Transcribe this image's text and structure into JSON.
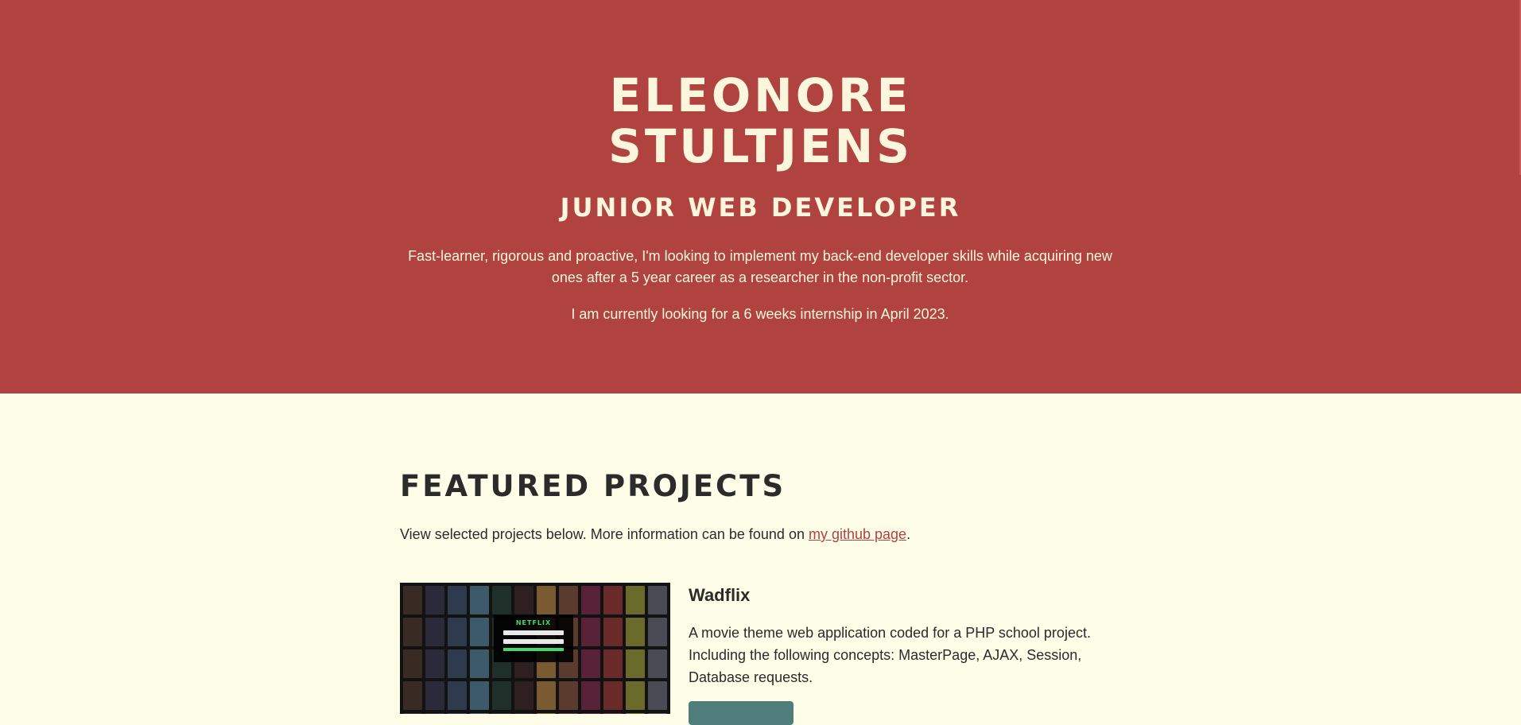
{
  "hero": {
    "name_line1": "ELEONORE",
    "name_line2": "STULTJENS",
    "role": "JUNIOR WEB DEVELOPER",
    "bio": "Fast-learner, rigorous and proactive, I'm looking to implement my back-end developer skills while acquiring new ones after a 5 year career as a researcher in the non-profit sector.",
    "availability": "I am currently looking for a 6 weeks internship in April 2023."
  },
  "projects": {
    "title": "FEATURED PROJECTS",
    "intro_prefix": "View selected projects below. More information can be found on ",
    "intro_link": "my github page",
    "intro_suffix": ".",
    "items": [
      {
        "name": "Wadflix",
        "description": "A movie theme web application coded for a PHP school project. Including the following concepts: MasterPage, AJAX, Session, Database requests.",
        "thumbnail_logo": "NETFLIX",
        "button_label": ""
      }
    ]
  },
  "colors": {
    "hero_bg": "#b04240",
    "page_bg": "#fdfde8",
    "accent_link": "#b04240",
    "button_bg": "#4e7d7c",
    "netflix_green": "#3ddc6b"
  }
}
